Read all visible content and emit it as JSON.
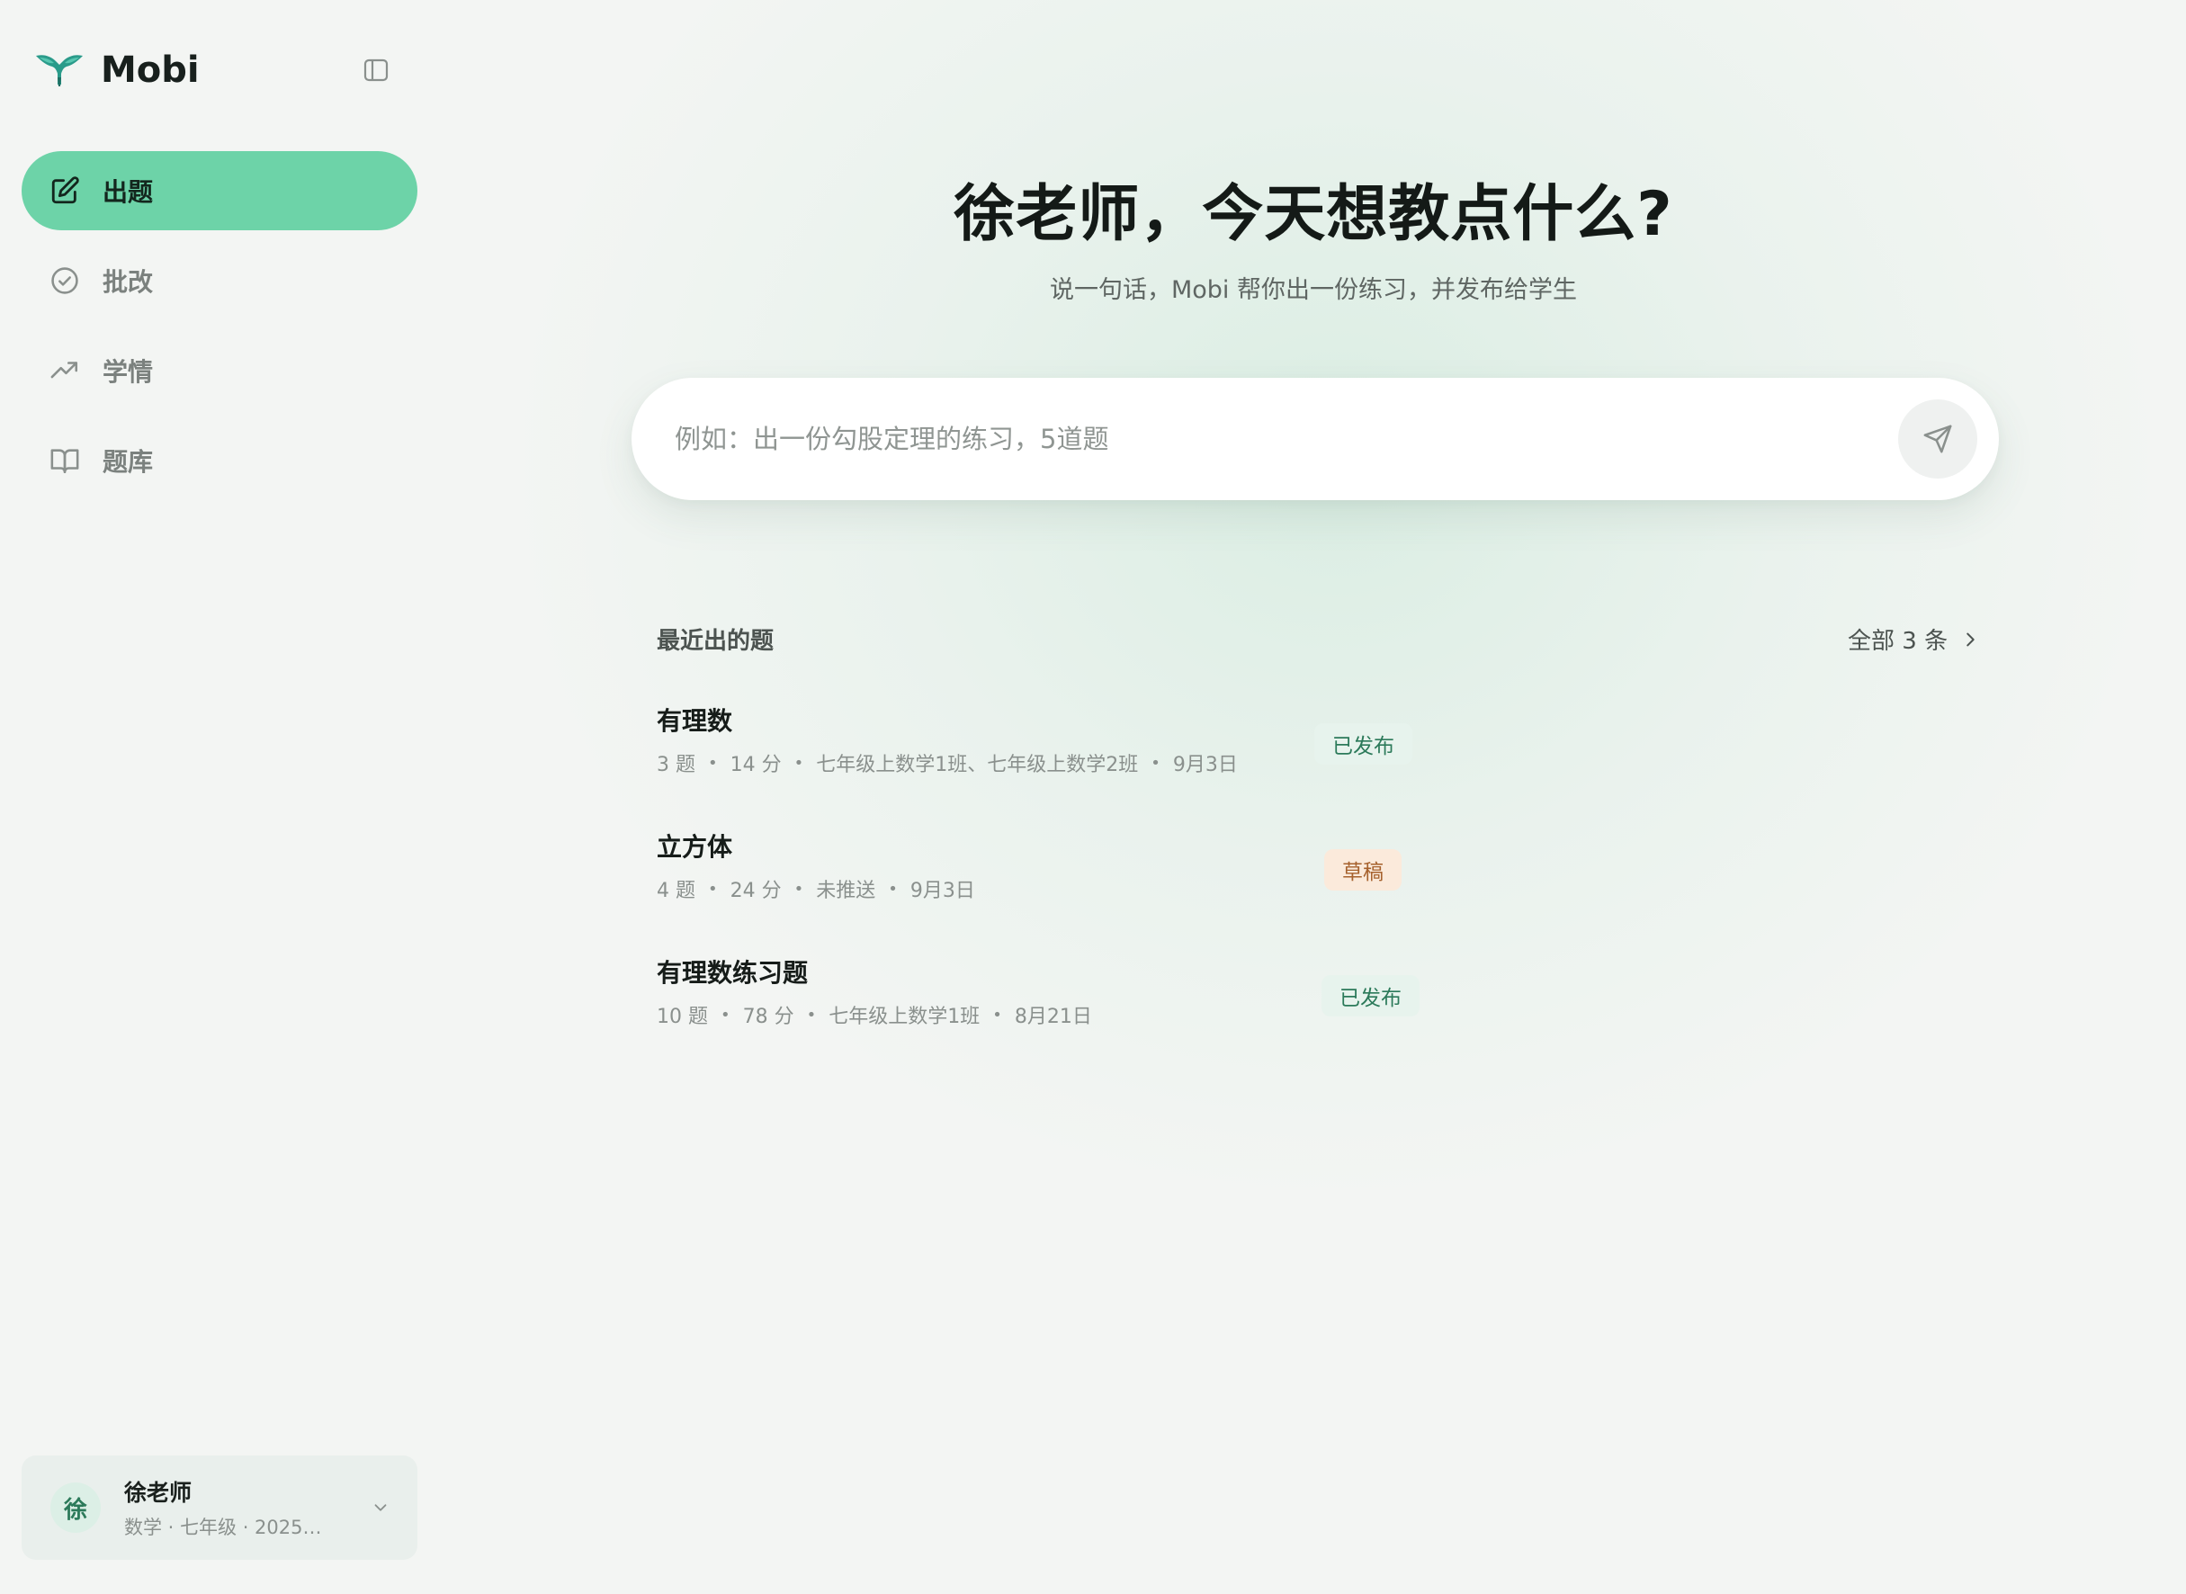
{
  "brand": {
    "name": "Mobi"
  },
  "nav": {
    "items": [
      {
        "label": "出题",
        "icon": "edit-icon",
        "active": true
      },
      {
        "label": "批改",
        "icon": "check-circle-icon",
        "active": false
      },
      {
        "label": "学情",
        "icon": "trending-up-icon",
        "active": false
      },
      {
        "label": "题库",
        "icon": "book-open-icon",
        "active": false
      }
    ]
  },
  "user": {
    "avatar": "徐",
    "name": "徐老师",
    "meta": "数学 · 七年级 · 2025…"
  },
  "main": {
    "greeting": "徐老师，今天想教点什么?",
    "subtitle": "说一句话，Mobi 帮你出一份练习，并发布给学生",
    "prompt": {
      "placeholder": "例如：出一份勾股定理的练习，5道题",
      "value": ""
    },
    "recent": {
      "title": "最近出的题",
      "view_all": "全部 3 条",
      "items": [
        {
          "title": "有理数",
          "questions": "3 题",
          "points": "14 分",
          "target": "七年级上数学1班、七年级上数学2班",
          "date": "9月3日",
          "status": "已发布",
          "status_type": "published"
        },
        {
          "title": "立方体",
          "questions": "4 题",
          "points": "24 分",
          "target": "未推送",
          "date": "9月3日",
          "status": "草稿",
          "status_type": "draft"
        },
        {
          "title": "有理数练习题",
          "questions": "10 题",
          "points": "78 分",
          "target": "七年级上数学1班",
          "date": "8月21日",
          "status": "已发布",
          "status_type": "published"
        }
      ]
    }
  },
  "colors": {
    "accent": "#6dd3a8",
    "published_text": "#2c7a5a",
    "draft_text": "#a6612d"
  }
}
